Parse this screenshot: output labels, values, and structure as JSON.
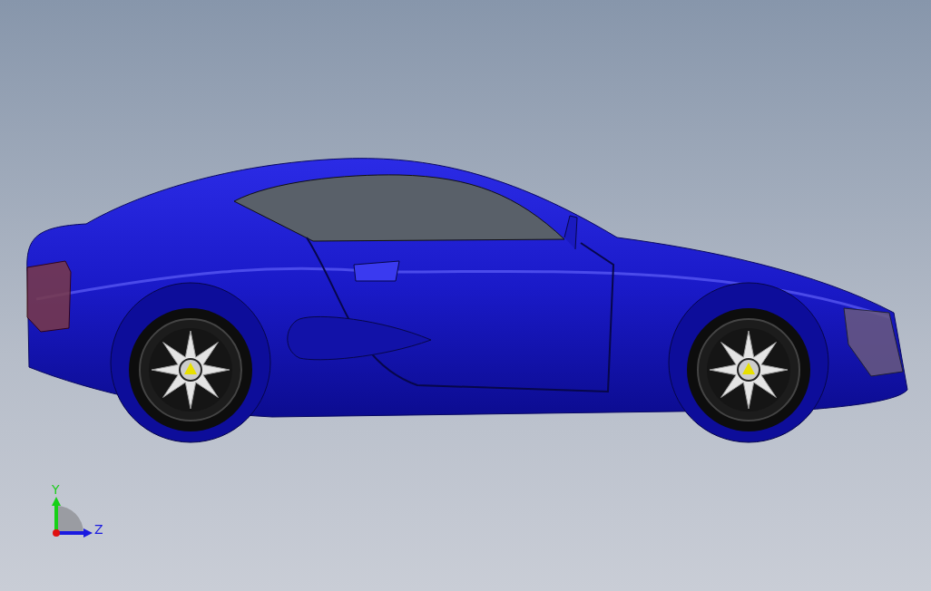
{
  "viewport": {
    "model": {
      "kind": "car"
    },
    "triad": {
      "axes": [
        {
          "kind": "y",
          "label": "Y"
        },
        {
          "kind": "z",
          "label": "Z"
        }
      ]
    }
  }
}
